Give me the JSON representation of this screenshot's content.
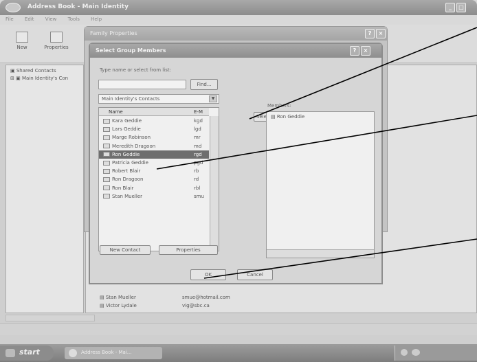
{
  "address_book": {
    "title": "Address Book - Main Identity",
    "menu": [
      "File",
      "Edit",
      "View",
      "Tools",
      "Help"
    ],
    "toolbar": {
      "new_label": "New",
      "properties_label": "Properties"
    },
    "tree": {
      "items": [
        "Shared Contacts",
        "Main Identity's Con"
      ]
    },
    "list_rows": [
      {
        "name": "Stan Mueller",
        "email": "smue@hotmail.com"
      },
      {
        "name": "Victor Lydale",
        "email": "vig@sbc.ca"
      }
    ]
  },
  "contact_properties": {
    "title": "Family Properties"
  },
  "dialog": {
    "title": "Select Group Members",
    "search_label": "Type name or select from list:",
    "search_value": "",
    "find_label": "Find...",
    "source_value": "Main Identity's Contacts",
    "col_name": "Name",
    "col_email": "E-M",
    "contacts": [
      {
        "name": "Kara Geddie",
        "email": "kgd"
      },
      {
        "name": "Lars Geddie",
        "email": "lgd"
      },
      {
        "name": "Marge Robinson",
        "email": "mr"
      },
      {
        "name": "Meredith Dragoon",
        "email": "md"
      },
      {
        "name": "Ron Geddie",
        "email": "rgd"
      },
      {
        "name": "Patricia Geddie",
        "email": "pgd"
      },
      {
        "name": "Robert Blair",
        "email": "rb"
      },
      {
        "name": "Ron Dragoon",
        "email": "rd"
      },
      {
        "name": "Ron Blair",
        "email": "rbl"
      },
      {
        "name": "Stan Mueller",
        "email": "smu"
      }
    ],
    "selected_contact_index": 4,
    "select_button": "Select ->",
    "members_label": "Members:",
    "members": [
      "Ron Geddie"
    ],
    "new_contact_button": "New Contact",
    "properties_button": "Properties",
    "ok_button": "OK",
    "cancel_button": "Cancel"
  },
  "taskbar": {
    "start_label": "start",
    "task_label": "Address Book - Mai..."
  },
  "colors": {
    "selection": "#6e6e6e",
    "callout_line": "#000000"
  }
}
